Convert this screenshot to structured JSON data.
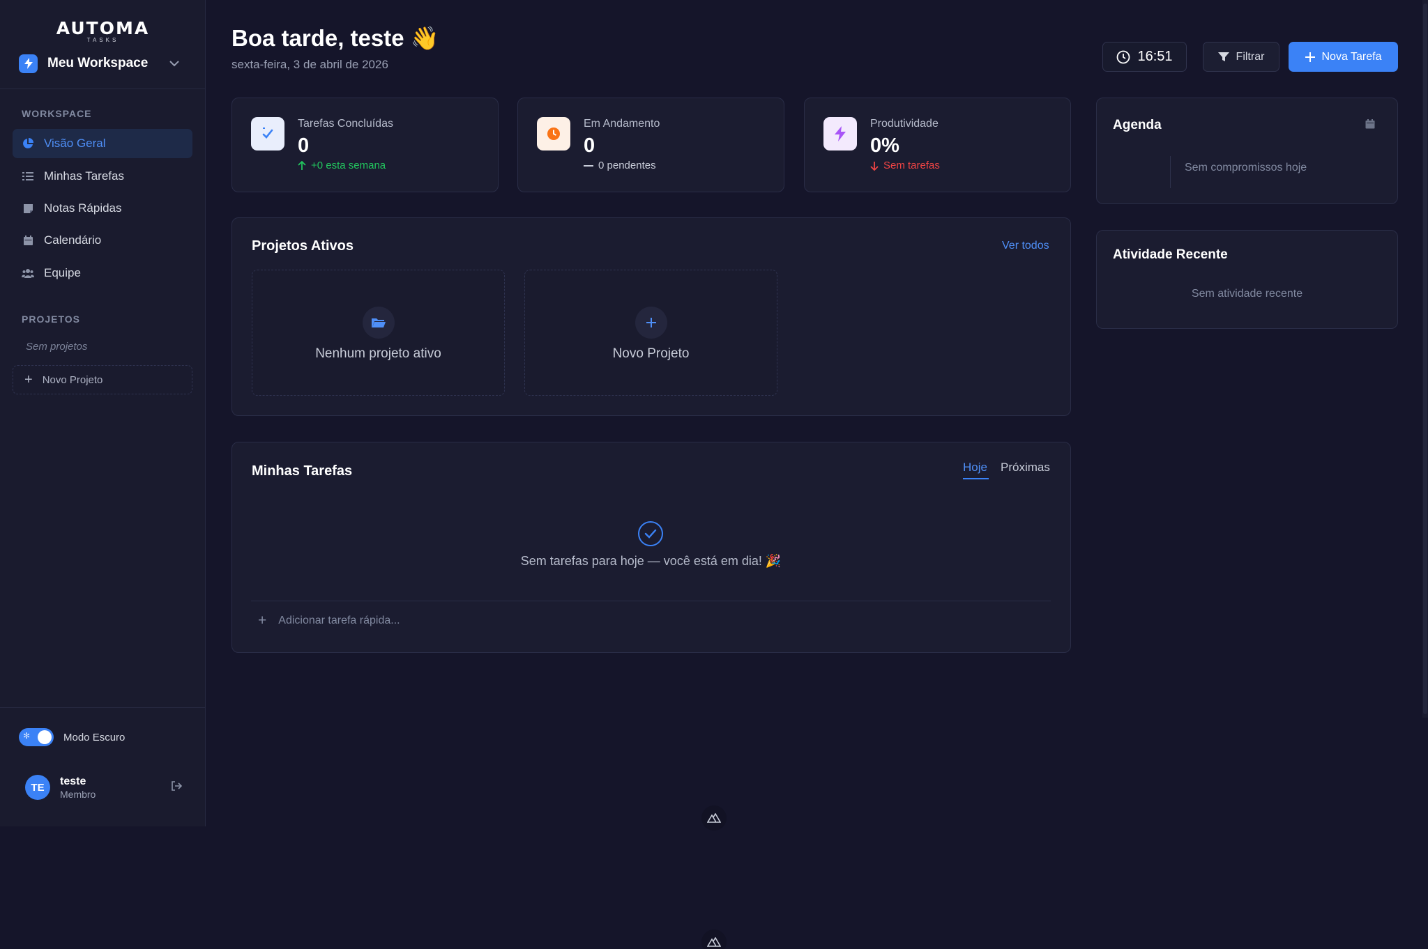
{
  "brand": {
    "logo_main": "AUTOMA",
    "logo_sub": "TASKS"
  },
  "workspace": {
    "name": "Meu Workspace",
    "icon": "lightning-icon"
  },
  "sidebar": {
    "section_workspace": "WORKSPACE",
    "items": [
      {
        "label": "Visão Geral",
        "icon": "pie-chart-icon",
        "active": true
      },
      {
        "label": "Minhas Tarefas",
        "icon": "list-check-icon"
      },
      {
        "label": "Notas Rápidas",
        "icon": "sticky-note-icon"
      },
      {
        "label": "Calendário",
        "icon": "calendar-icon"
      },
      {
        "label": "Equipe",
        "icon": "users-icon"
      }
    ],
    "section_projects": "PROJETOS",
    "no_projects": "Sem projetos",
    "new_project": "Novo Projeto",
    "dark_mode_label": "Modo Escuro",
    "dark_mode_on": true,
    "user": {
      "initials": "TE",
      "name": "teste",
      "role": "Membro"
    }
  },
  "header": {
    "greeting": "Boa tarde, teste 👋",
    "date": "sexta-feira, 3 de abril de 2026",
    "time": "16:51",
    "filter_label": "Filtrar",
    "new_task_label": "Nova Tarefa"
  },
  "stats": [
    {
      "label": "Tarefas Concluídas",
      "value": "0",
      "trend": "+0 esta semana",
      "trend_color": "#22c55e",
      "icon": "check-badge-icon",
      "icon_color": "#3b82f6"
    },
    {
      "label": "Em Andamento",
      "value": "0",
      "trend": "0 pendentes",
      "trend_color": "#c8ccd8",
      "icon": "clock-icon",
      "icon_color": "#f97316"
    },
    {
      "label": "Produtividade",
      "value": "0%",
      "trend": "Sem tarefas",
      "trend_color": "#ef4444",
      "icon": "bolt-icon",
      "icon_color": "#a855f7"
    }
  ],
  "projects": {
    "title": "Projetos Ativos",
    "see_all": "Ver todos",
    "empty_label": "Nenhum projeto ativo",
    "new_label": "Novo Projeto"
  },
  "tasks": {
    "title": "Minhas Tarefas",
    "tabs": [
      "Hoje",
      "Próximas"
    ],
    "active_tab": "Hoje",
    "empty_message": "Sem tarefas para hoje — você está em dia! 🎉",
    "quick_add_placeholder": "Adicionar tarefa rápida..."
  },
  "agenda": {
    "title": "Agenda",
    "empty": "Sem compromissos hoje"
  },
  "activity": {
    "title": "Atividade Recente",
    "empty": "Sem atividade recente"
  },
  "colors": {
    "accent": "#3b82f6",
    "background": "#15152a",
    "card": "#1b1c30"
  }
}
